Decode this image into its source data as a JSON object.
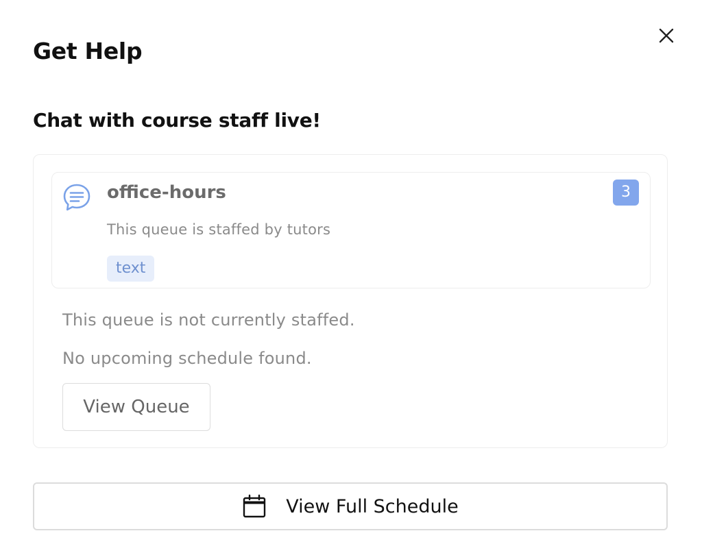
{
  "dialog": {
    "title": "Get Help",
    "close_icon": "close-icon"
  },
  "section": {
    "heading": "Chat with course staff live!"
  },
  "queue": {
    "icon": "chat-bubble-icon",
    "name": "office-hours",
    "description": "This queue is staffed by tutors",
    "tag": "text",
    "count": "3",
    "status_text": "This queue is not currently staffed.",
    "schedule_text": "No upcoming schedule found.",
    "view_button_label": "View Queue"
  },
  "footer": {
    "icon": "calendar-icon",
    "schedule_button_label": "View Full Schedule"
  },
  "colors": {
    "accent": "#82a6ec",
    "tag_bg": "#e7eefb",
    "tag_text": "#6e90cf",
    "muted_text": "#8a8a8a",
    "border": "#dcdcdc"
  }
}
